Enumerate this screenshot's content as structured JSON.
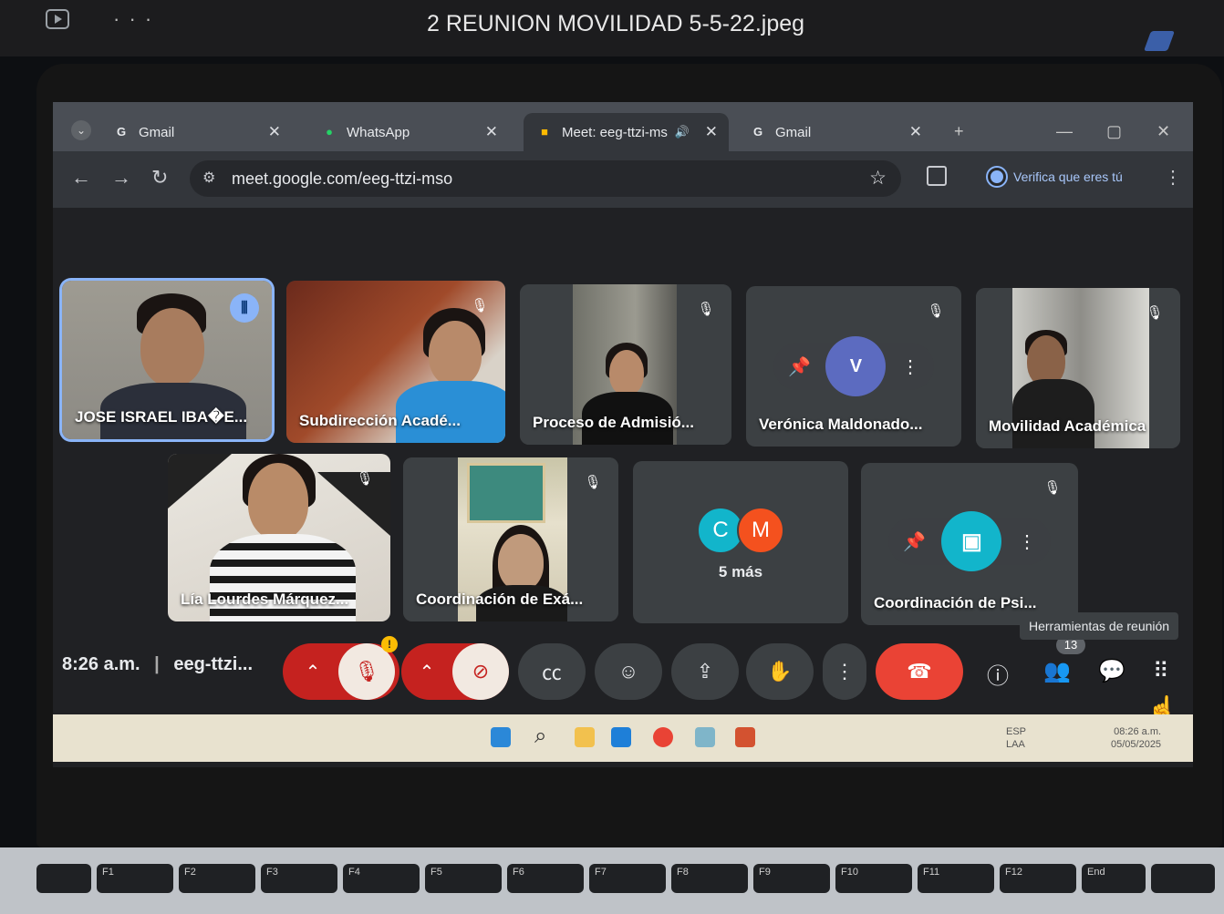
{
  "viewer": {
    "title": "2 REUNION MOVILIDAD 5-5-22.jpeg",
    "more": "· · ·"
  },
  "browser": {
    "tabs": [
      {
        "label": "Gmail",
        "icon": "G",
        "icon_color": "#e8eaed"
      },
      {
        "label": "WhatsApp",
        "icon": "●",
        "icon_color": "#25d366"
      },
      {
        "label": "Meet: eeg-ttzi-ms",
        "icon": "■",
        "icon_color": "#ffba00",
        "audio": "🔊"
      },
      {
        "label": "Gmail",
        "icon": "G",
        "icon_color": "#e8eaed"
      }
    ],
    "close_glyph": "✕",
    "new_tab": "+",
    "url": "meet.google.com/eeg-ttzi-mso",
    "verify_label": "Verifica que eres tú"
  },
  "meet": {
    "participants": [
      {
        "name": "JOSE ISRAEL IBA�E..."
      },
      {
        "name": "Subdirección Acadé..."
      },
      {
        "name": "Proceso de Admisió..."
      },
      {
        "name": "Verónica Maldonado...",
        "avatar": "V"
      },
      {
        "name": "Movilidad Académica"
      },
      {
        "name": "Lía Lourdes Márquez..."
      },
      {
        "name": "Coordinación de Exá..."
      },
      {
        "name": "Coordinación de Psi..."
      }
    ],
    "more": {
      "avatars": [
        "C",
        "M"
      ],
      "label": "5 más"
    },
    "clock": "8:26 a.m.",
    "separator": "|",
    "meeting_code": "eeg-ttzi...",
    "participant_count": "13",
    "tooltip": "Herramientas de reunión",
    "warning": "!",
    "colors": {
      "accent": "#8ab4f8",
      "hangup": "#ea4335",
      "muted_red": "#c5221f",
      "avatar_c": "#12b5cb",
      "avatar_m": "#f4511e",
      "avatar_v": "#5c6bc0"
    }
  },
  "taskbar": {
    "lang": "ESP",
    "lang2": "LAA",
    "time": "08:26 a.m.",
    "date": "05/05/2025"
  },
  "keyboard": {
    "fkeys": [
      "F1",
      "F2",
      "F3",
      "F4",
      "F5",
      "F6",
      "F7",
      "F8",
      "F9",
      "F10",
      "F11",
      "F12",
      "End"
    ],
    "row2": [
      "!",
      "\"",
      "#",
      "$",
      "%",
      "&",
      "/",
      "(",
      ")",
      "=",
      "?",
      "¿"
    ]
  }
}
